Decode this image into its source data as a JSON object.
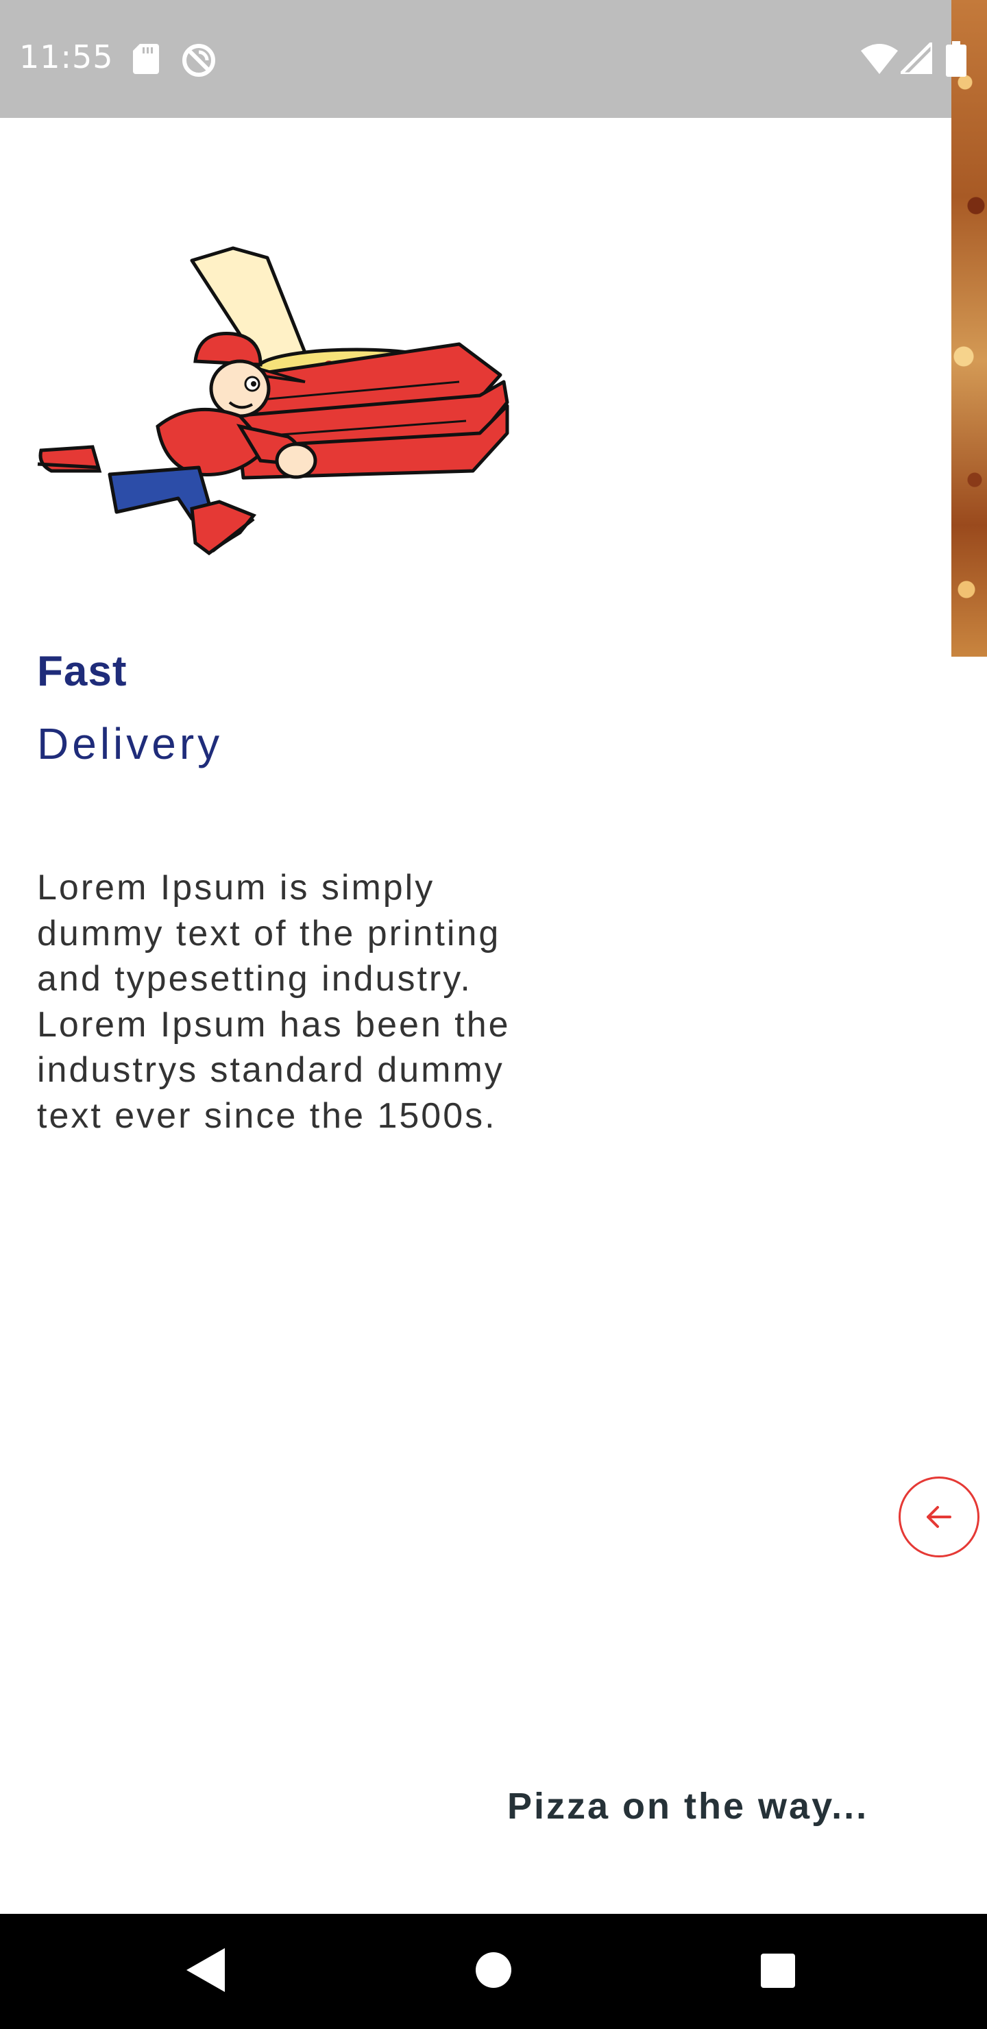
{
  "status_bar": {
    "time": "11:55",
    "icons": [
      "sd-card-icon",
      "sync-off-icon",
      "wifi-icon",
      "signal-icon",
      "battery-icon"
    ],
    "background": "#bdbdbd"
  },
  "onboarding": {
    "title_bold": "Fast",
    "title_light": "Delivery",
    "description": "Lorem Ipsum is simply dummy text of the printing and typesetting industry. Lorem Ipsum has been the industrys standard dummy text ever since the 1500s.",
    "back_icon": "arrow-left-icon",
    "caption": "Pizza on the way...",
    "accent_color": "#e53935",
    "title_color": "#1f2c7a"
  },
  "nav_bar": {
    "buttons": [
      "back-triangle-icon",
      "home-circle-icon",
      "recents-square-icon"
    ]
  }
}
